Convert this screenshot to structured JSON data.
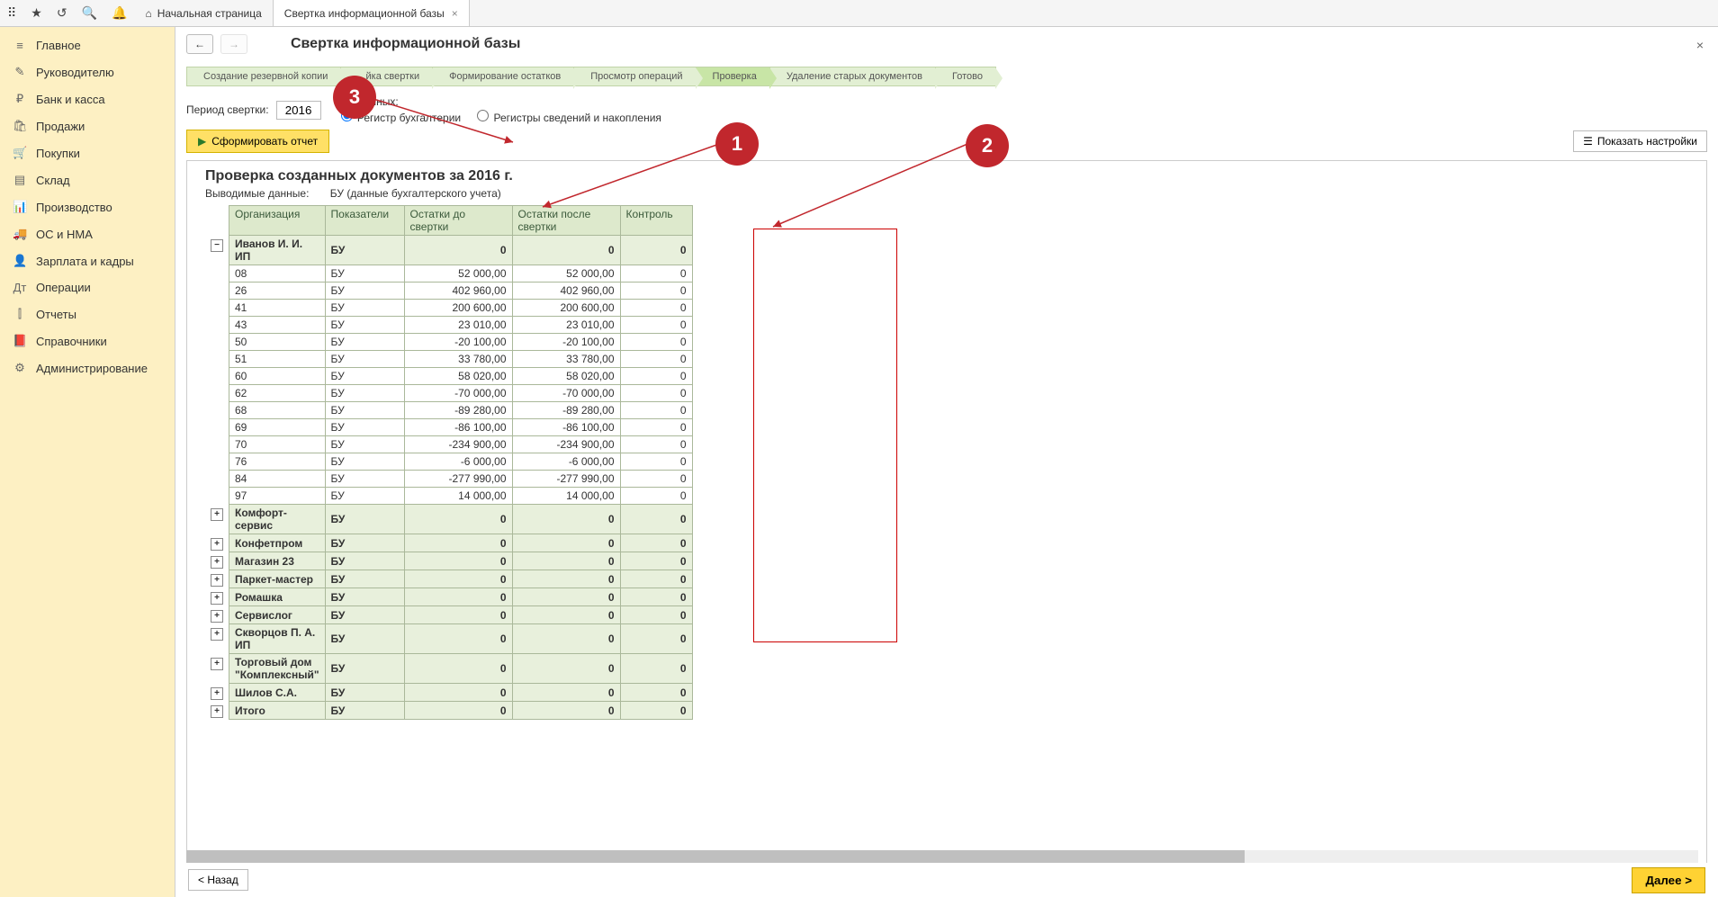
{
  "topbar": {
    "tabs": [
      {
        "label": "Начальная страница",
        "home": true
      },
      {
        "label": "Свертка информационной базы",
        "closable": true
      }
    ]
  },
  "sidebar": {
    "items": [
      {
        "icon": "≡",
        "label": "Главное"
      },
      {
        "icon": "✎",
        "label": "Руководителю"
      },
      {
        "icon": "₽",
        "label": "Банк и касса"
      },
      {
        "icon": "🛍",
        "label": "Продажи"
      },
      {
        "icon": "🛒",
        "label": "Покупки"
      },
      {
        "icon": "▤",
        "label": "Склад"
      },
      {
        "icon": "📊",
        "label": "Производство"
      },
      {
        "icon": "🚚",
        "label": "ОС и НМА"
      },
      {
        "icon": "👤",
        "label": "Зарплата и кадры"
      },
      {
        "icon": "Дт",
        "label": "Операции"
      },
      {
        "icon": "⫿",
        "label": "Отчеты"
      },
      {
        "icon": "📕",
        "label": "Справочники"
      },
      {
        "icon": "⚙",
        "label": "Администрирование"
      }
    ]
  },
  "page": {
    "title": "Свертка информационной базы",
    "steps": [
      "Создание резервной копии",
      "...йка свертки",
      "Формирование остатков",
      "Просмотр операций",
      "Проверка",
      "Удаление старых документов",
      "Готово"
    ],
    "active_step": 4,
    "period_label": "Период свертки:",
    "period_value": "2016",
    "type_label": "Тип данных:",
    "radio1": "Регистр бухгалтерии",
    "radio2": "Регистры сведений и накопления",
    "form_btn": "Сформировать отчет",
    "settings_btn": "Показать настройки",
    "back_btn": "< Назад",
    "next_btn": "Далее >"
  },
  "report": {
    "title": "Проверка созданных документов за 2016 г.",
    "sub_label": "Выводимые данные:",
    "sub_value": "БУ (данные бухгалтерского учета)",
    "headers": {
      "org": "Организация",
      "ind": "Показатели",
      "before": "Остатки до свертки",
      "after": "Остатки после свертки",
      "ctrl": "Контроль"
    },
    "groups": [
      {
        "org": "Иванов И. И. ИП",
        "ind": "БУ",
        "before": "0",
        "after": "0",
        "ctrl": "0",
        "expanded": true,
        "rows": [
          {
            "org": "08",
            "ind": "БУ",
            "before": "52 000,00",
            "after": "52 000,00",
            "ctrl": "0"
          },
          {
            "org": "26",
            "ind": "БУ",
            "before": "402 960,00",
            "after": "402 960,00",
            "ctrl": "0"
          },
          {
            "org": "41",
            "ind": "БУ",
            "before": "200 600,00",
            "after": "200 600,00",
            "ctrl": "0"
          },
          {
            "org": "43",
            "ind": "БУ",
            "before": "23 010,00",
            "after": "23 010,00",
            "ctrl": "0"
          },
          {
            "org": "50",
            "ind": "БУ",
            "before": "-20 100,00",
            "after": "-20 100,00",
            "ctrl": "0"
          },
          {
            "org": "51",
            "ind": "БУ",
            "before": "33 780,00",
            "after": "33 780,00",
            "ctrl": "0"
          },
          {
            "org": "60",
            "ind": "БУ",
            "before": "58 020,00",
            "after": "58 020,00",
            "ctrl": "0"
          },
          {
            "org": "62",
            "ind": "БУ",
            "before": "-70 000,00",
            "after": "-70 000,00",
            "ctrl": "0"
          },
          {
            "org": "68",
            "ind": "БУ",
            "before": "-89 280,00",
            "after": "-89 280,00",
            "ctrl": "0"
          },
          {
            "org": "69",
            "ind": "БУ",
            "before": "-86 100,00",
            "after": "-86 100,00",
            "ctrl": "0"
          },
          {
            "org": "70",
            "ind": "БУ",
            "before": "-234 900,00",
            "after": "-234 900,00",
            "ctrl": "0"
          },
          {
            "org": "76",
            "ind": "БУ",
            "before": "-6 000,00",
            "after": "-6 000,00",
            "ctrl": "0"
          },
          {
            "org": "84",
            "ind": "БУ",
            "before": "-277 990,00",
            "after": "-277 990,00",
            "ctrl": "0"
          },
          {
            "org": "97",
            "ind": "БУ",
            "before": "14 000,00",
            "after": "14 000,00",
            "ctrl": "0"
          }
        ]
      },
      {
        "org": "Комфорт-сервис",
        "ind": "БУ",
        "before": "0",
        "after": "0",
        "ctrl": "0"
      },
      {
        "org": "Конфетпром",
        "ind": "БУ",
        "before": "0",
        "after": "0",
        "ctrl": "0"
      },
      {
        "org": "Магазин 23",
        "ind": "БУ",
        "before": "0",
        "after": "0",
        "ctrl": "0"
      },
      {
        "org": "Паркет-мастер",
        "ind": "БУ",
        "before": "0",
        "after": "0",
        "ctrl": "0"
      },
      {
        "org": "Ромашка",
        "ind": "БУ",
        "before": "0",
        "after": "0",
        "ctrl": "0"
      },
      {
        "org": "Сервислог",
        "ind": "БУ",
        "before": "0",
        "after": "0",
        "ctrl": "0"
      },
      {
        "org": "Скворцов П. А. ИП",
        "ind": "БУ",
        "before": "0",
        "after": "0",
        "ctrl": "0"
      },
      {
        "org": "Торговый дом \"Комплексный\"",
        "ind": "БУ",
        "before": "0",
        "after": "0",
        "ctrl": "0"
      },
      {
        "org": "Шилов С.А.",
        "ind": "БУ",
        "before": "0",
        "after": "0",
        "ctrl": "0"
      },
      {
        "org": "Итого",
        "ind": "БУ",
        "before": "0",
        "after": "0",
        "ctrl": "0"
      }
    ]
  },
  "callouts": {
    "1": "1",
    "2": "2",
    "3": "3"
  }
}
